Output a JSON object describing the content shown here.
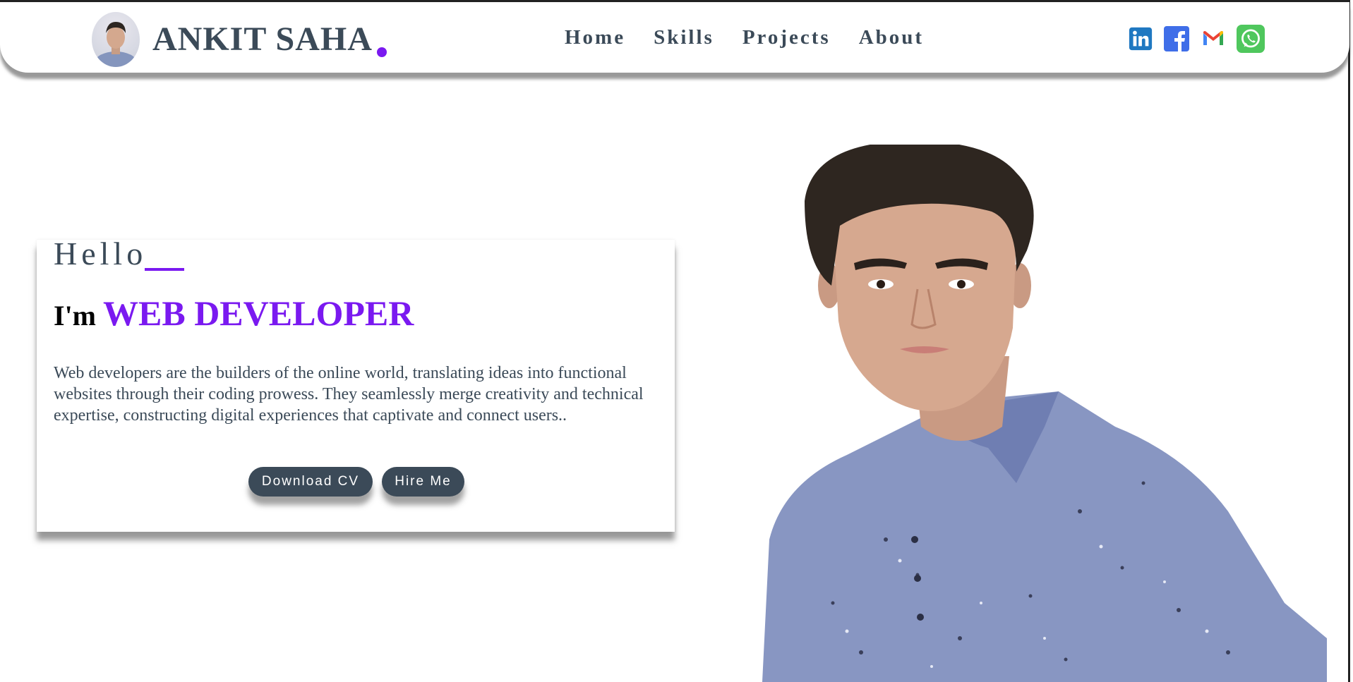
{
  "header": {
    "brand_name": "ANKIT SAHA",
    "nav": [
      "Home",
      "Skills",
      "Projects",
      "About"
    ],
    "social": [
      "linkedin-icon",
      "facebook-icon",
      "gmail-icon",
      "whatsapp-icon"
    ]
  },
  "hero": {
    "greeting": "Hello",
    "im": "I'm",
    "role": "WEB DEVELOPER",
    "description": "Web developers are the builders of the online world, translating ideas into functional websites through their coding prowess. They seamlessly merge creativity and technical expertise, constructing digital experiences that captivate and connect users..",
    "download_cv": "Download CV",
    "hire_me": "Hire Me"
  },
  "colors": {
    "accent": "#7a19f0",
    "text_dark": "#3b4a58",
    "button_bg": "#3b4a58"
  }
}
